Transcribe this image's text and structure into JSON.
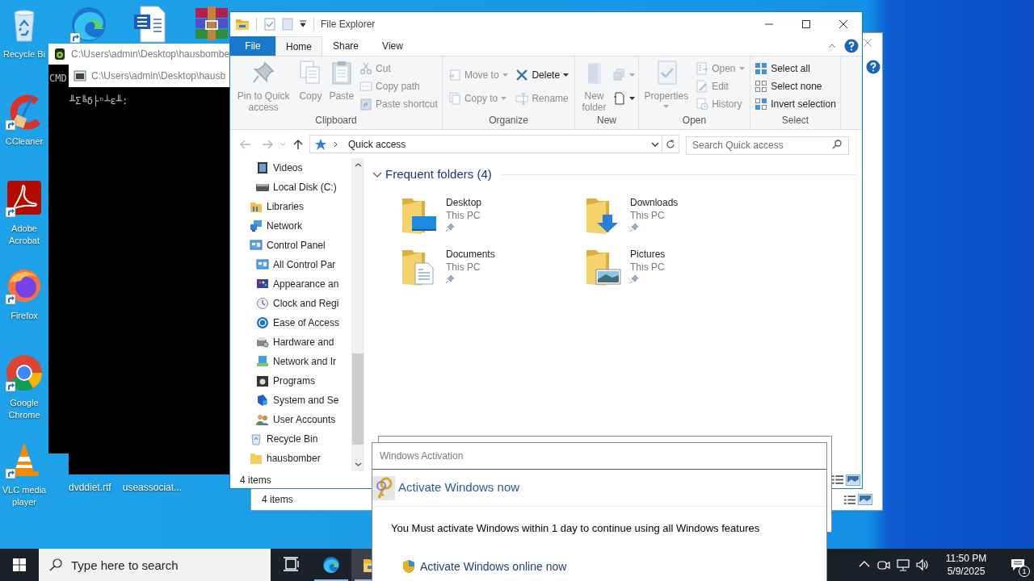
{
  "desktop": {
    "left_icons": [
      {
        "label": "Recycle Bi",
        "kind": "recycle_bin",
        "shortcut": false
      },
      {
        "label": "CCleaner",
        "kind": "ccleaner",
        "shortcut": true
      },
      {
        "label": "Adobe Acrobat",
        "kind": "acrobat",
        "shortcut": true
      },
      {
        "label": "Firefox",
        "kind": "firefox",
        "shortcut": true
      },
      {
        "label": "Google Chrome",
        "kind": "chrome",
        "shortcut": true
      },
      {
        "label": "VLC media player",
        "kind": "vlc",
        "shortcut": true
      }
    ],
    "top_icons": [
      {
        "kind": "edge",
        "shortcut": true
      },
      {
        "kind": "word",
        "shortcut": false
      },
      {
        "kind": "winrar",
        "shortcut": false
      }
    ],
    "bottom_labels": [
      "dvddiet.rtf",
      "useassociat..."
    ]
  },
  "console_windows": [
    {
      "title": "C:\\Users\\admin\\Desktop\\hausbombe",
      "kind": "app",
      "text": "CMD"
    },
    {
      "title": "C:\\Users\\admin\\Desktop\\hausb",
      "kind": "console",
      "text": "╨Σ╚δ├ⁿ┴ε╨:"
    }
  ],
  "background_explorer": {
    "status": "4 items"
  },
  "explorer": {
    "title": "File Explorer",
    "tabs": [
      {
        "label": "File",
        "kind": "file",
        "selected": false
      },
      {
        "label": "Home",
        "kind": "tab",
        "selected": true
      },
      {
        "label": "Share",
        "kind": "tab",
        "selected": false
      },
      {
        "label": "View",
        "kind": "tab",
        "selected": false
      }
    ],
    "ribbon_groups": [
      {
        "label": "Clipboard",
        "items": [
          {
            "kind": "large",
            "label": "Pin to Quick access",
            "disabled": true,
            "dropdown": false
          },
          {
            "kind": "large",
            "label": "Copy",
            "disabled": true,
            "dropdown": false
          },
          {
            "kind": "large",
            "label": "Paste",
            "disabled": true,
            "dropdown": false
          },
          {
            "kind": "stack",
            "commands": [
              {
                "label": "Cut",
                "disabled": true,
                "dropdown": false
              },
              {
                "label": "Copy path",
                "disabled": true,
                "dropdown": false
              },
              {
                "label": "Paste shortcut",
                "disabled": true,
                "dropdown": false
              }
            ]
          }
        ]
      },
      {
        "label": "Organize",
        "items": [
          {
            "kind": "stack",
            "commands": [
              {
                "label": "Move to",
                "disabled": true,
                "dropdown": true
              },
              {
                "label": "Copy to",
                "disabled": true,
                "dropdown": true
              }
            ]
          },
          {
            "kind": "stack",
            "commands": [
              {
                "label": "Delete",
                "disabled": false,
                "dropdown": true
              },
              {
                "label": "Rename",
                "disabled": true,
                "dropdown": false
              }
            ]
          }
        ]
      },
      {
        "label": "New",
        "items": [
          {
            "kind": "large",
            "label": "New folder",
            "disabled": true,
            "dropdown": false
          },
          {
            "kind": "stack",
            "commands": [
              {
                "disabled": true,
                "dropdown": true
              },
              {
                "disabled": false,
                "dropdown": true
              }
            ]
          }
        ]
      },
      {
        "label": "Open",
        "items": [
          {
            "kind": "large",
            "label": "Properties",
            "disabled": true,
            "dropdown": true
          },
          {
            "kind": "stack",
            "commands": [
              {
                "label": "Open",
                "disabled": true,
                "dropdown": true
              },
              {
                "label": "Edit",
                "disabled": true,
                "dropdown": false
              },
              {
                "label": "History",
                "disabled": true,
                "dropdown": false
              }
            ]
          }
        ]
      },
      {
        "label": "Select",
        "items": [
          {
            "kind": "stack",
            "commands": [
              {
                "label": "Select all",
                "disabled": false,
                "dropdown": false
              },
              {
                "label": "Select none",
                "disabled": false,
                "dropdown": false
              },
              {
                "label": "Invert selection",
                "disabled": false,
                "dropdown": false
              }
            ]
          }
        ]
      }
    ],
    "address": {
      "location": "Quick access"
    },
    "search": {
      "placeholder": "Search Quick access"
    },
    "nav_pane": {
      "continued_items": [
        {
          "label": "Videos",
          "kind": "videos"
        },
        {
          "label": "Local Disk (C:)",
          "kind": "disk"
        }
      ],
      "items": [
        {
          "label": "Libraries",
          "kind": "libraries"
        },
        {
          "label": "Network",
          "kind": "network"
        },
        {
          "label": "Control Panel",
          "kind": "control_panel",
          "children": [
            {
              "label": "All Control Par",
              "kind": "control_panel"
            },
            {
              "label": "Appearance an",
              "kind": "appearance"
            },
            {
              "label": "Clock and Regi",
              "kind": "clock"
            },
            {
              "label": "Ease of Access",
              "kind": "ease"
            },
            {
              "label": "Hardware and",
              "kind": "hardware"
            },
            {
              "label": "Network and Ir",
              "kind": "network_internet"
            },
            {
              "label": "Programs",
              "kind": "programs"
            },
            {
              "label": "System and Se",
              "kind": "system"
            },
            {
              "label": "User Accounts",
              "kind": "users"
            }
          ]
        },
        {
          "label": "Recycle Bin",
          "kind": "recycle_bin"
        },
        {
          "label": "hausbomber",
          "kind": "folder"
        }
      ]
    },
    "section": {
      "title": "Frequent folders (4)",
      "expanded": true,
      "folders": [
        {
          "name": "Desktop",
          "location": "This PC",
          "kind": "desktop",
          "pinned": true
        },
        {
          "name": "Downloads",
          "location": "This PC",
          "kind": "downloads",
          "pinned": true
        },
        {
          "name": "Documents",
          "location": "This PC",
          "kind": "documents",
          "pinned": true
        },
        {
          "name": "Pictures",
          "location": "This PC",
          "kind": "pictures",
          "pinned": true
        }
      ]
    },
    "status": "4 items"
  },
  "activation_dialog": {
    "title": "Windows Activation",
    "heading": "Activate Windows now",
    "message": "You Must activate Windows within 1 day to continue using all Windows features",
    "link": "Activate Windows online now"
  },
  "taskbar": {
    "search": {
      "placeholder": "Type here to search"
    },
    "apps": [
      {
        "kind": "task_view",
        "running": false,
        "active": false
      },
      {
        "kind": "edge",
        "running": true,
        "active": false
      },
      {
        "kind": "explorer",
        "running": true,
        "active": true
      }
    ],
    "clock": {
      "time": "11:50 PM",
      "date": "5/9/2025"
    },
    "notification_count": "1"
  }
}
